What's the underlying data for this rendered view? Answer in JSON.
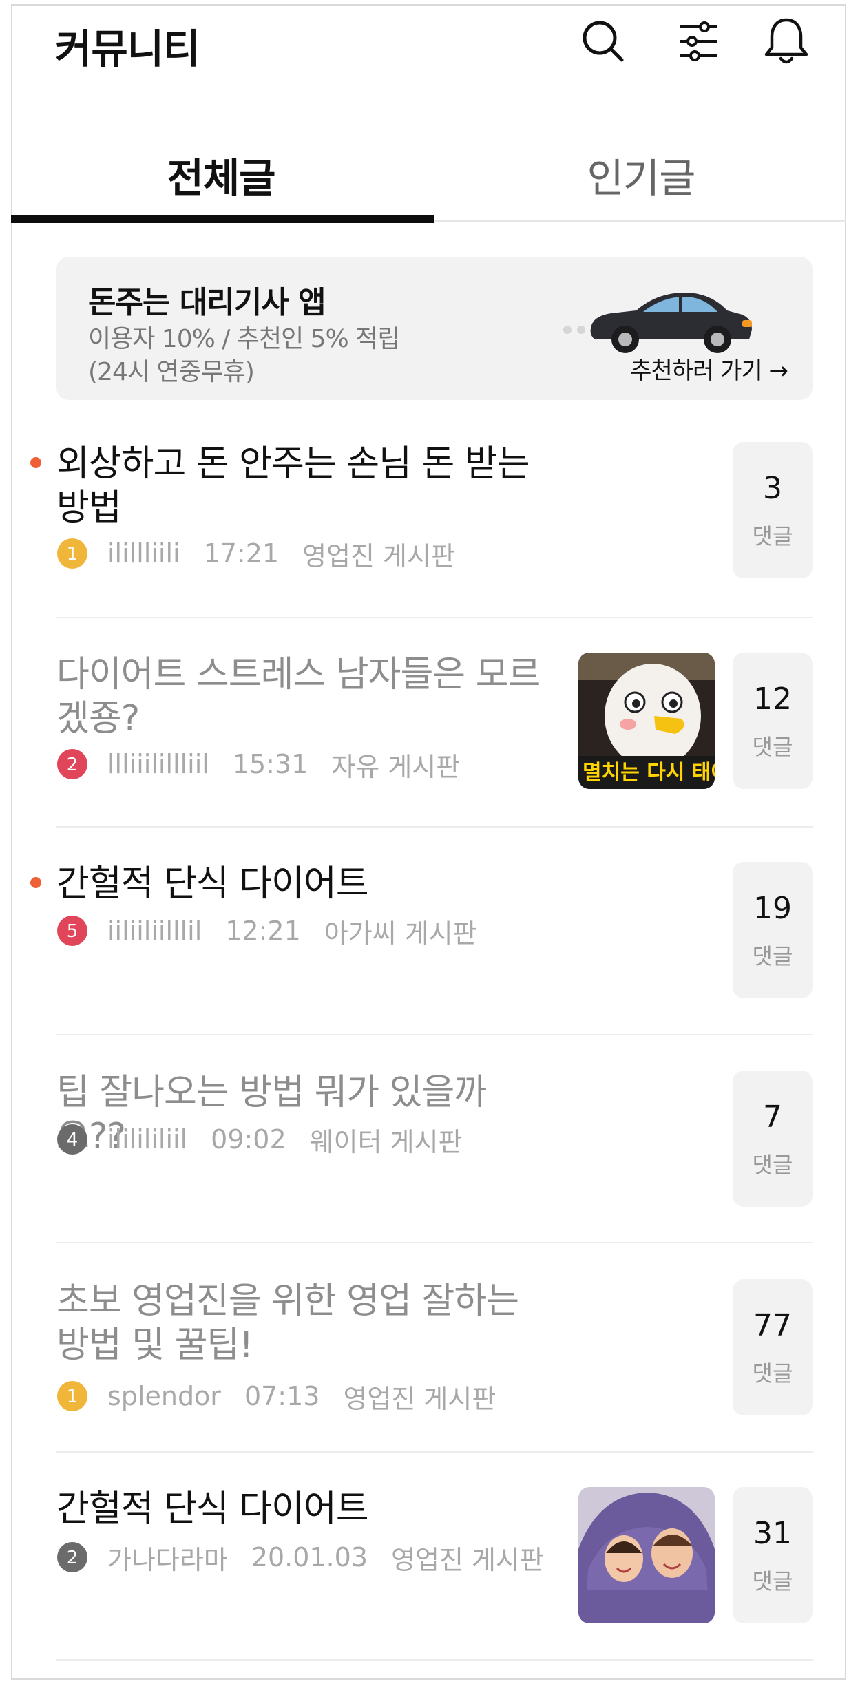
{
  "header": {
    "title": "커뮤니티",
    "icons": [
      "search-icon",
      "filter-icon",
      "bell-icon"
    ]
  },
  "tabs": [
    {
      "label": "전체글",
      "active": true
    },
    {
      "label": "인기글",
      "active": false
    }
  ],
  "banner": {
    "title": "돈주는 대리기사 앱",
    "line1": "이용자 10% /  추천인 5% 적립",
    "line2": "(24시 연중무휴)",
    "link": "추천하러 가기 →"
  },
  "comment_label": "댓글",
  "posts": [
    {
      "title": "외상하고 돈 안주는 손님 돈 받는 방법",
      "new": true,
      "read": false,
      "rank": "1",
      "rank_color": "#f0b63a",
      "author": "ilillliili",
      "time": "17:21",
      "board": "영업진 게시판",
      "comments": "3",
      "thumbnail": null
    },
    {
      "title": "다이어트 스트레스 남자들은 모르겠죵?",
      "new": false,
      "read": true,
      "rank": "2",
      "rank_color": "#e0455a",
      "author": "llliiilillliil",
      "time": "15:31",
      "board": "자유 게시판",
      "comments": "12",
      "thumbnail": "penguin-character",
      "thumb_caption": "멸치는 다시 태어"
    },
    {
      "title": "간헐적 단식 다이어트",
      "new": true,
      "read": false,
      "rank": "5",
      "rank_color": "#e0455a",
      "author": "iiliiliilllil",
      "time": "12:21",
      "board": "아가씨 게시판",
      "comments": "19",
      "thumbnail": null
    },
    {
      "title": "팁 잘나오는 방법 뭐가 있을까요??",
      "new": false,
      "read": true,
      "rank": "4",
      "rank_color": "#6b6b6b",
      "author": "ililililiil",
      "time": "09:02",
      "board": "웨이터 게시판",
      "comments": "7",
      "thumbnail": null
    },
    {
      "title": "초보 영업진을 위한 영업 잘하는 방법 및 꿀팁!",
      "new": false,
      "read": true,
      "rank": "1",
      "rank_color": "#f0b63a",
      "author": "splendor",
      "time": "07:13",
      "board": "영업진 게시판",
      "comments": "77",
      "thumbnail": null
    },
    {
      "title": "간헐적 단식 다이어트",
      "new": false,
      "read": false,
      "rank": "2",
      "rank_color": "#6b6b6b",
      "author": "가나다라마",
      "time": "20.01.03",
      "board": "영업진 게시판",
      "comments": "31",
      "thumbnail": "two-people-under-blanket"
    }
  ]
}
